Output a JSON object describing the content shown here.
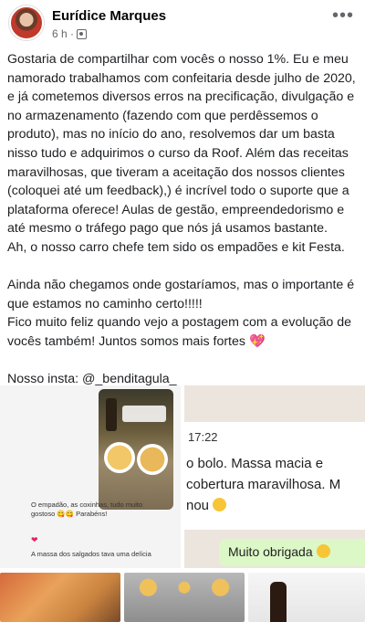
{
  "post": {
    "author": "Eurídice Marques",
    "time": "6 h ·",
    "privacy_icon": "friends-icon",
    "more_label": "•••",
    "paragraphs": [
      "Gostaria de compartilhar com vocês o nosso 1%. Eu e meu namorado trabalhamos com confeitaria desde julho de 2020, e já cometemos diversos erros na precificação, divulgação e no armazenamento (fazendo com que perdêssemos o produto), mas no início do ano, resolvemos dar um basta nisso tudo e adquirimos o curso da Roof. Além das receitas maravilhosas, que tiveram a aceitação dos nossos clientes (coloquei até um feedback),) é incrível todo o suporte que a plataforma oferece! Aulas de gestão, empreendedorismo e até mesmo o tráfego pago que nós já usamos bastante.\nAh, o nosso carro chefe tem sido os empadões e kit Festa.",
      "Ainda não chegamos onde gostaríamos, mas o importante é que estamos no caminho certo!!!!!\nFico muito feliz quando vejo a postagem com a evolução de vocês também! Juntos somos mais fortes",
      "Nosso insta: @_benditagula_"
    ],
    "heart_emoji": "💖"
  },
  "media": {
    "story": {
      "comment1": "O empadão, as coxinhas, tudo muito gostoso 😋😋 Parabéns!",
      "comment_heart": "❤",
      "comment2": "A massa dos salgados tava uma delícia"
    },
    "chat": {
      "time": "17:22",
      "message": "o bolo. Massa macia e\n cobertura maravilhosa. M\nnou",
      "reply": "Muito obrigada"
    }
  }
}
